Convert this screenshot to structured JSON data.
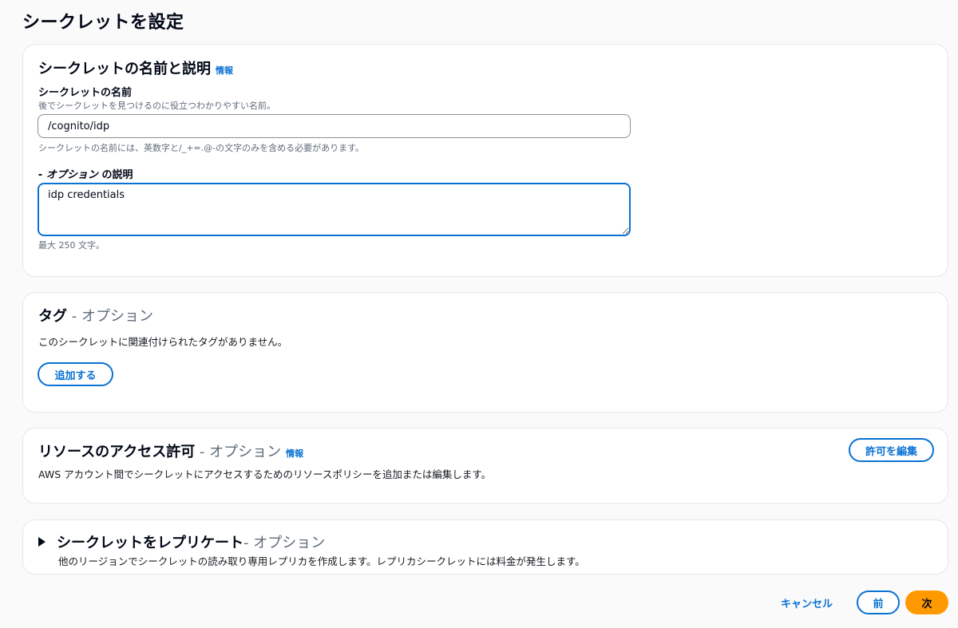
{
  "page": {
    "title": "シークレットを設定"
  },
  "name_section": {
    "title": "シークレットの名前と説明",
    "info": "情報",
    "name_label": "シークレットの名前",
    "name_hint": "後でシークレットを見つけるのに役立つわかりやすい名前。",
    "name_value": "/cognito/idp",
    "name_constraint": "シークレットの名前には、英数字と/_+=.@-の文字のみを含める必要があります。",
    "desc_label_prefix": "- オプション",
    "desc_label_suffix": " の説明",
    "desc_value": "idp credentials",
    "desc_constraint": "最大 250 文字。"
  },
  "tags_section": {
    "title": "タグ",
    "optional": " - オプション",
    "empty_text": "このシークレットに関連付けられたタグがありません。",
    "add_button": "追加する"
  },
  "access_section": {
    "title": "リソースのアクセス許可",
    "optional": " - オプション",
    "info": "情報",
    "description": "AWS アカウント間でシークレットにアクセスするためのリソースポリシーを追加または編集します。",
    "edit_button": "許可を編集"
  },
  "replicate_section": {
    "expand_icon": "caret-right-icon",
    "title": "シークレットをレプリケート",
    "optional": " - オプション",
    "description": "他のリージョンでシークレットの読み取り専用レプリカを作成します。レプリカシークレットには料金が発生します。"
  },
  "footer": {
    "cancel": "キャンセル",
    "previous": "前",
    "next": "次"
  },
  "colors": {
    "accent": "#0972d3",
    "primary": "#ff9900",
    "border": "#e4e6ea"
  }
}
